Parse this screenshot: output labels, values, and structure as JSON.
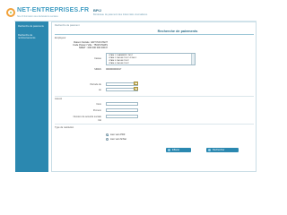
{
  "header": {
    "logo_text": "NET-ENTREPRISES.FR",
    "logo_subtitle": "Site d'information des déclarations sociales",
    "app_title": "BPIJ",
    "app_subtitle": "Bordereau de paiement des Indemnités Journalières"
  },
  "sidebar": {
    "items": [
      {
        "label": "Recherche de paiements"
      },
      {
        "label": "Recherche de remboursements"
      }
    ]
  },
  "main": {
    "breadcrumb": "Recherche de paiement",
    "title": "Recherche de paiements",
    "employer_section_label": "Employeur",
    "employer_info": [
      "Raison Sociale : ENT PAS PANT",
      "Code Postal / Ville : 75015 PARIS",
      "SIRET : 000 000 000 00047"
    ],
    "fields": {
      "caisse_label": "Caisse",
      "caisse_options": [
        "CPAM 1 CHAMBÉRY TEST",
        "CPAM 2 CAISSE TEST ZONE 2",
        "CPAM 3 CAISSE TEST",
        "CPAM 4 CAISSE TEST"
      ],
      "siren_label": "SIREN",
      "siren_value": "0000000000017",
      "date_from_label": "Période du",
      "date_to_label": "au"
    },
    "assure_section_label": "Assuré",
    "assure_fields": {
      "nom_label": "Nom",
      "prenom_label": "Prénom",
      "nir_label": "Numéro de sécurité sociale",
      "cle_label": "Clé"
    },
    "result_section_label": "Type de restitution",
    "result_options": [
      {
        "label": "Lien vers PDF",
        "checked": true
      },
      {
        "label": "Lien vers fichier",
        "checked": false
      }
    ],
    "buttons": {
      "reset_label": "Effacer",
      "search_label": "Rechercher"
    }
  }
}
